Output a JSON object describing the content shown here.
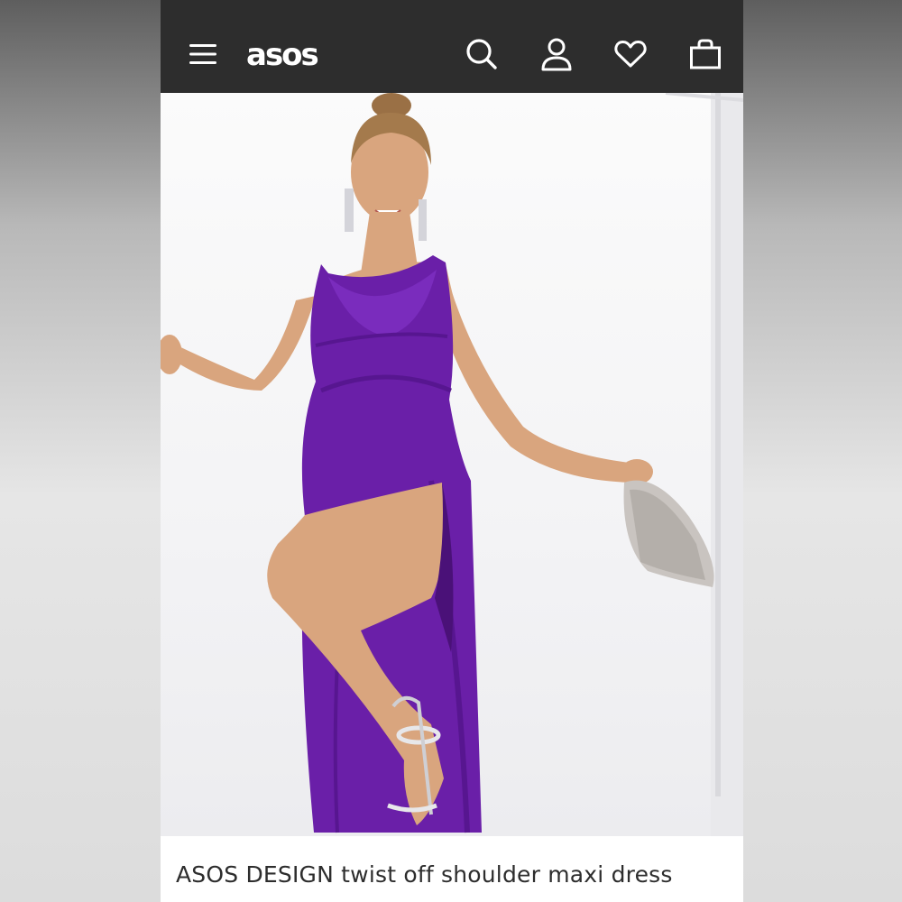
{
  "header": {
    "logo_text": "asos",
    "menu_icon": "hamburger-menu-icon",
    "search_icon": "search-icon",
    "account_icon": "user-account-icon",
    "wishlist_icon": "heart-icon",
    "bag_icon": "shopping-bag-icon",
    "background_color": "#2d2d2d",
    "icon_color": "#ffffff"
  },
  "product": {
    "title": "ASOS DESIGN twist off shoulder maxi dress",
    "dress_color": "#6a1fa8"
  }
}
